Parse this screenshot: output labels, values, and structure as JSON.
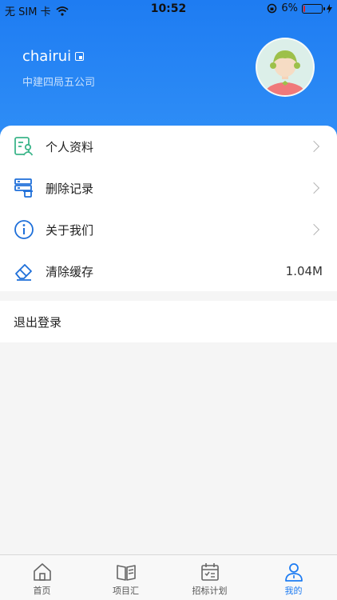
{
  "status_bar": {
    "carrier": "无 SIM 卡",
    "time": "10:52",
    "battery": "6%"
  },
  "profile": {
    "username": "chairui",
    "company": "中建四局五公司"
  },
  "menu": [
    {
      "label": "个人资料",
      "icon": "profile-doc-icon"
    },
    {
      "label": "删除记录",
      "icon": "delete-record-icon"
    },
    {
      "label": "关于我们",
      "icon": "info-icon"
    },
    {
      "label": "清除缓存",
      "icon": "eraser-icon",
      "value": "1.04M"
    }
  ],
  "logout_label": "退出登录",
  "tabs": [
    {
      "label": "首页",
      "icon": "home-icon"
    },
    {
      "label": "项目汇",
      "icon": "book-icon"
    },
    {
      "label": "招标计划",
      "icon": "calendar-icon"
    },
    {
      "label": "我的",
      "icon": "person-icon",
      "active": true
    }
  ],
  "colors": {
    "accent": "#1e7cf2",
    "icon_green": "#3cb58a",
    "icon_blue": "#1e6fd9"
  }
}
